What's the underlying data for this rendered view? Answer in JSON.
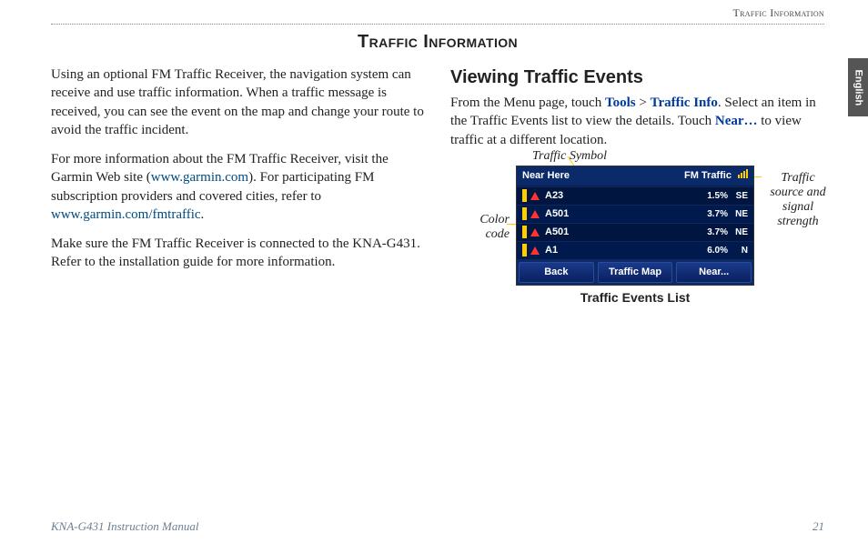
{
  "running_head": "Traffic Information",
  "side_tab": "English",
  "title": "Traffic Information",
  "left": {
    "p1": "Using an optional FM Traffic Receiver, the navigation system can receive and use traffic information. When a traffic message is received, you can see the event on the map and change your route to avoid the traffic incident.",
    "p2a": "For more information about the FM Traffic Receiver, visit the Garmin Web site (",
    "p2_link1": "www.garmin.com",
    "p2b": "). For participating FM subscription providers and covered cities, refer to ",
    "p2_link2": "www.garmin.com/fmtraffic",
    "p2c": ".",
    "p3": "Make sure the FM Traffic Receiver is connected to the KNA-G431. Refer to the installation guide for more information."
  },
  "right": {
    "heading": "Viewing Traffic Events",
    "p1a": "From the Menu page, touch ",
    "touch_tools": "Tools",
    "gt": " > ",
    "touch_traffic": "Traffic Info",
    "p1b": ". Select an item in the Traffic Events list to view the details. Touch ",
    "touch_near": "Near…",
    "p1c": " to view traffic at a different location."
  },
  "annotations": {
    "top": "Traffic Symbol",
    "left": "Color code",
    "right": "Traffic source and signal strength",
    "caption": "Traffic Events List"
  },
  "device": {
    "header_left": "Near Here",
    "header_right": "FM Traffic",
    "rows": [
      {
        "road": "A23",
        "dist": "1.5%",
        "dir": "SE"
      },
      {
        "road": "A501",
        "dist": "3.7%",
        "dir": "NE"
      },
      {
        "road": "A501",
        "dist": "3.7%",
        "dir": "NE"
      },
      {
        "road": "A1",
        "dist": "6.0%",
        "dir": "N"
      }
    ],
    "btn_back": "Back",
    "btn_map": "Traffic Map",
    "btn_near": "Near..."
  },
  "footer": {
    "left": "KNA-G431 Instruction Manual",
    "right": "21"
  }
}
